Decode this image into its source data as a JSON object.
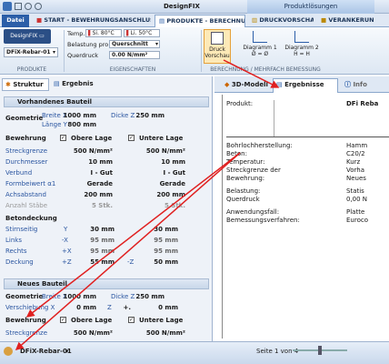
{
  "app": {
    "title": "DesignFIX",
    "context_tab": "Produktlösungen"
  },
  "ribbon_tabs": {
    "datei": "Datei",
    "start": "START - BEWEHRUNGSANSCHLUSS",
    "produkte": "PRODUKTE - BERECHNUNG",
    "druck": "DRUCKVORSCHAU",
    "verank": "VERANKERUN"
  },
  "ribbon": {
    "product_select": "DFiX-Rebar-01",
    "temp_label": "Temp.",
    "temp1": "Si. 80°C",
    "temp2": "Li. 50°C",
    "belastung_label": "Belastung pro",
    "belastung_value": "Querschnitt",
    "querdruck_label": "Querdruck",
    "querdruck_value": "0.00 N/mm²",
    "druck_label": "Druck Vorschau",
    "diag1_label": "Diagramm 1",
    "diag1_sub": "Ø = Ø",
    "diag2_label": "Diagramm 2",
    "diag2_sub": "H = H",
    "group_produkte": "PRODUKTE",
    "group_eigenschaften": "EIGENSCHAFTEN",
    "group_berechnung": "BERECHNUNG / MEHRFACH BEMESSUNG"
  },
  "left": {
    "tab_struktur": "Struktur",
    "tab_ergebnis": "Ergebnis",
    "sec1": "Vorhandenes Bauteil",
    "geometrie": "Geometrie",
    "breite_x": "Breite X",
    "breite_x_val": "1000 mm",
    "dicke_z": "Dicke Z",
    "dicke_z_val": "250 mm",
    "laenge_y": "Länge Y",
    "laenge_y_val": "800 mm",
    "bewehrung": "Bewehrung",
    "obere_lage": "Obere Lage",
    "untere_lage": "Untere Lage",
    "rows": [
      {
        "label": "Streckgrenze",
        "a": "500 N/mm²",
        "b": "500 N/mm²"
      },
      {
        "label": "Durchmesser",
        "a": "10 mm",
        "b": "10 mm"
      },
      {
        "label": "Verbund",
        "a": "I - Gut",
        "b": "I - Gut"
      },
      {
        "label": "Formbeiwert α1",
        "a": "Gerade",
        "b": "Gerade"
      },
      {
        "label": "Achsabstand",
        "a": "200 mm",
        "b": "200 mm"
      },
      {
        "label": "Anzahl Stäbe",
        "a": "5 Stk.",
        "b": "5 Stk."
      }
    ],
    "betondeckung": "Betondeckung",
    "cover_rows": [
      {
        "label": "Stirnseitig",
        "s": "Y",
        "a": "30 mm",
        "b": "30 mm"
      },
      {
        "label": "Links",
        "s": "-X",
        "a": "95 mm",
        "b": "95 mm"
      },
      {
        "label": "Rechts",
        "s": "+X",
        "a": "95 mm",
        "b": "95 mm"
      },
      {
        "label": "Deckung",
        "s": "+Z",
        "a": "55 mm",
        "sb": "-Z",
        "b": "50 mm"
      }
    ],
    "sec2": "Neues Bauteil",
    "geometrie2": "Geometrie",
    "breite_x2": "Breite X",
    "breite_x2_val": "1000 mm",
    "dicke_z2": "Dicke Z",
    "dicke_z2_val": "250 mm",
    "verschiebung": "Verschiebung X",
    "versch_x": "0 mm",
    "versch_z_lbl": "Z",
    "versch_z": "0 mm",
    "versch_plus": "+.",
    "bewehrung2": "Bewehrung",
    "obere_lage2": "Obere Lage",
    "untere_lage2": "Untere Lage",
    "streck2": "Streckgrenze",
    "streck2_a": "500 N/mm²",
    "streck2_b": "500 N/mm²"
  },
  "right": {
    "tab_3d": "3D-Modell",
    "tab_ergebnisse": "Ergebnisse",
    "tab_info": "Info",
    "produkt_label": "Produkt:",
    "produkt_val": "DFi Reba",
    "rows": [
      {
        "k": "Bohrlochherstellung:",
        "v": "Hamm"
      },
      {
        "k": "Beton:",
        "v": "C20/2"
      },
      {
        "k": "Temperatur:",
        "v": "Kurz"
      },
      {
        "k": "Streckgrenze der",
        "v": "Vorha"
      },
      {
        "k": "Bewehrung:",
        "v": "Neues"
      },
      {
        "k": "Belastung:",
        "v": "Statis"
      },
      {
        "k": "Querdruck",
        "v": "0,00 N"
      },
      {
        "k": "Anwendungsfall:",
        "v": "Platte"
      },
      {
        "k": "Bemessungsverfahren:",
        "v": "Euroco"
      }
    ]
  },
  "status": {
    "product": "DFiX-Rebar-01",
    "page": "Seite 1 von 4"
  },
  "colors": {
    "accent": "#e02020",
    "ribbon": "#dfe8f4",
    "active_tab": "#ffffff"
  }
}
